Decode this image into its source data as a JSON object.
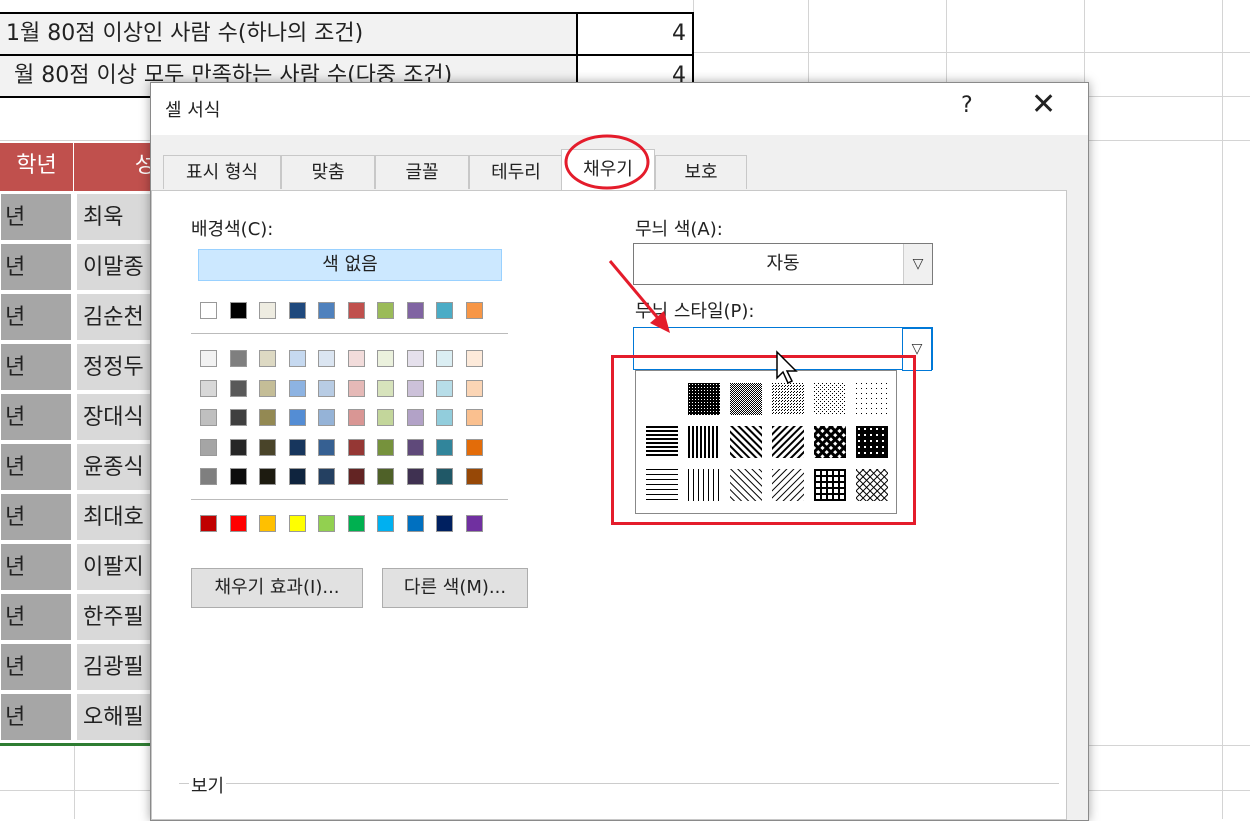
{
  "sheet": {
    "row1_label": "1월 80점 이상인 사람 수(하나의 조건)",
    "row1_value": "4",
    "row2_label": "월 80점 이상 모두 만족하는 사람 수(다중 조건)",
    "row2_value": "4",
    "header_grade": "학년",
    "header_name": "성",
    "grades": [
      "년",
      "년",
      "년",
      "년",
      "년",
      "년",
      "년",
      "년",
      "년",
      "년",
      "년"
    ],
    "names": [
      "최욱",
      "이말종",
      "김순천",
      "정정두",
      "장대식",
      "윤종식",
      "최대호",
      "이팔지",
      "한주필",
      "김광필",
      "오해필"
    ]
  },
  "dialog": {
    "title": "셀 서식",
    "help": "?",
    "close": "✕",
    "tabs": [
      "표시 형식",
      "맞춤",
      "글꼴",
      "테두리",
      "채우기",
      "보호"
    ],
    "bg_color_label": "배경색(C):",
    "no_color_button": "색 없음",
    "fill_effects_button": "채우기 효과(I)...",
    "more_colors_button": "다른 색(M)...",
    "pattern_color_label": "무늬 색(A):",
    "pattern_color_value": "자동",
    "pattern_style_label": "무늬 스타일(P):",
    "pattern_style_value": "",
    "preview_label": "보기"
  },
  "colors": {
    "theme_row": [
      "#ffffff",
      "#000000",
      "#eeece1",
      "#1f497d",
      "#4f81bd",
      "#c0504d",
      "#9bbb59",
      "#8064a2",
      "#4bacc6",
      "#f79646"
    ],
    "shades": [
      [
        "#f2f2f2",
        "#7f7f7f",
        "#ddd9c3",
        "#c6d9f0",
        "#dbe5f1",
        "#f2dcdb",
        "#ebf1dd",
        "#e5e0ec",
        "#dbeef3",
        "#fdeada"
      ],
      [
        "#d8d8d8",
        "#595959",
        "#c4bd97",
        "#8db3e2",
        "#b8cce4",
        "#e5b9b7",
        "#d7e3bc",
        "#ccc1d9",
        "#b7dde8",
        "#fbd5b5"
      ],
      [
        "#bfbfbf",
        "#3f3f3f",
        "#938953",
        "#548dd4",
        "#95b3d7",
        "#d99694",
        "#c3d69b",
        "#b2a2c7",
        "#92cddc",
        "#fac08f"
      ],
      [
        "#a5a5a5",
        "#262626",
        "#494429",
        "#17365d",
        "#366092",
        "#953734",
        "#76923c",
        "#5f497a",
        "#31859b",
        "#e36c09"
      ],
      [
        "#7f7f7f",
        "#0c0c0c",
        "#1d1b10",
        "#0f243e",
        "#244061",
        "#632423",
        "#4f6128",
        "#3f3151",
        "#205867",
        "#974806"
      ]
    ],
    "standard": [
      "#c00000",
      "#ff0000",
      "#ffc000",
      "#ffff00",
      "#92d050",
      "#00b050",
      "#00b0f0",
      "#0070c0",
      "#002060",
      "#7030a0"
    ]
  }
}
